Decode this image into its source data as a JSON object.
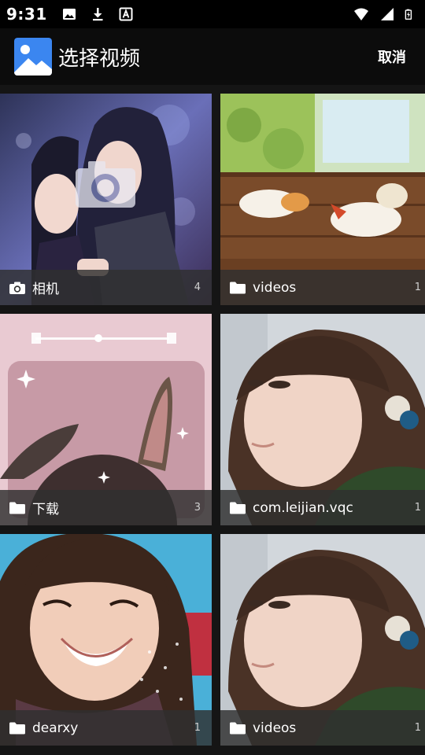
{
  "status_bar": {
    "time": "9:31",
    "left_icons": [
      "image-icon",
      "download-icon",
      "font-icon"
    ],
    "right_icons": [
      "wifi-icon",
      "signal-icon",
      "battery-icon"
    ]
  },
  "app_bar": {
    "logo_icon": "gallery-logo-icon",
    "title": "选择视频",
    "cancel_label": "取消"
  },
  "albums": [
    {
      "name": "相机",
      "count": "4",
      "icon": "camera-icon",
      "thumbnail": "anime-couple-illustration"
    },
    {
      "name": "videos",
      "count": "1",
      "icon": "folder-icon",
      "thumbnail": "cartoon-dogs-on-porch"
    },
    {
      "name": "下载",
      "count": "3",
      "icon": "folder-icon",
      "thumbnail": "pink-bunny-ears-girl"
    },
    {
      "name": "com.leijian.vqc",
      "count": "1",
      "icon": "folder-icon",
      "thumbnail": "girl-with-bangs-profile"
    },
    {
      "name": "dearxy",
      "count": "1",
      "icon": "folder-icon",
      "thumbnail": "smiling-girl-snow"
    },
    {
      "name": "videos",
      "count": "1",
      "icon": "folder-icon",
      "thumbnail": "girl-with-bangs-profile"
    }
  ],
  "colors": {
    "background": "#151515",
    "app_bar": "#0c0c0c",
    "status_bar": "#000000",
    "tile_bar": "#303030",
    "logo_blue": "#3b86f0"
  }
}
